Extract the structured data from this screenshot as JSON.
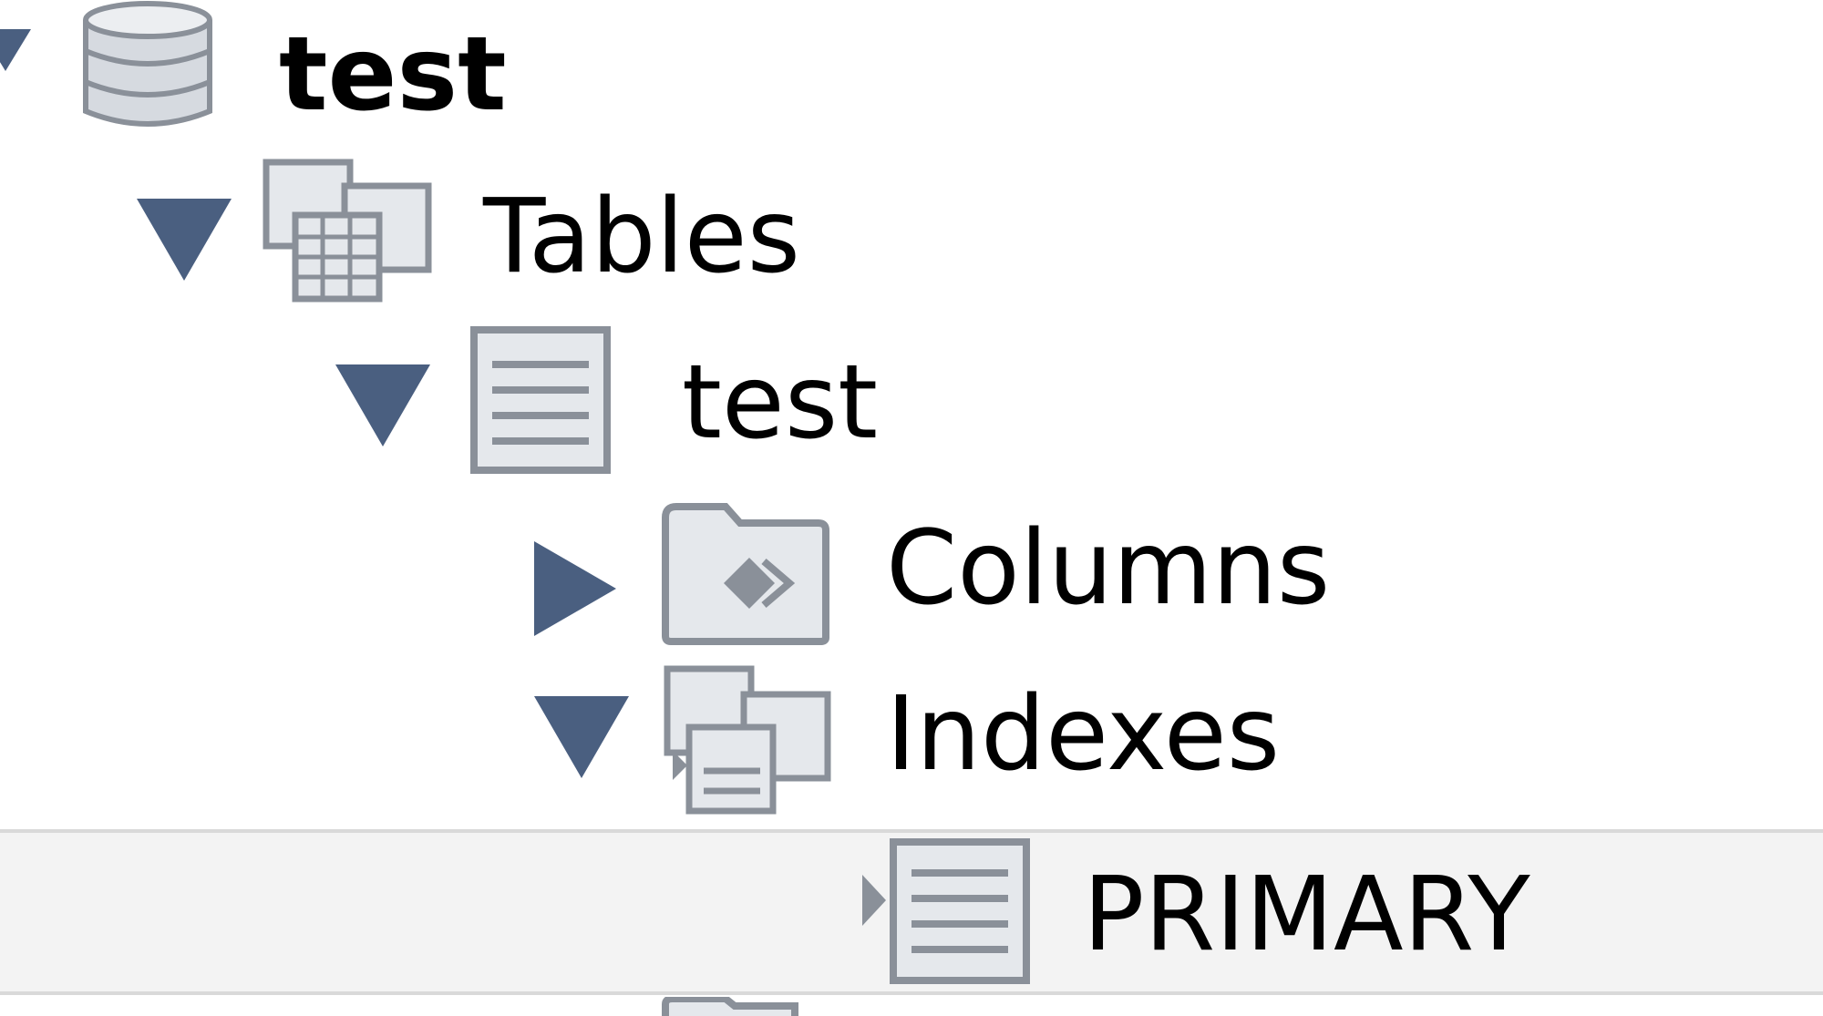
{
  "tree": {
    "nodes": [
      {
        "label": "test",
        "icon": "database-icon",
        "state": "expanded",
        "bold": true
      },
      {
        "label": "Tables",
        "icon": "tables-group-icon",
        "state": "expanded"
      },
      {
        "label": "test",
        "icon": "table-icon",
        "state": "expanded"
      },
      {
        "label": "Columns",
        "icon": "columns-folder-icon",
        "state": "collapsed"
      },
      {
        "label": "Indexes",
        "icon": "indexes-group-icon",
        "state": "expanded"
      },
      {
        "label": "PRIMARY",
        "icon": "index-icon",
        "state": "leaf",
        "selected": true
      }
    ]
  },
  "colors": {
    "arrow": "#4a5f80",
    "icon_stroke": "#7f8a96",
    "icon_fill": "#dfe3e8",
    "selection_bg": "#f3f3f3",
    "selection_border": "#d9d9d9"
  }
}
